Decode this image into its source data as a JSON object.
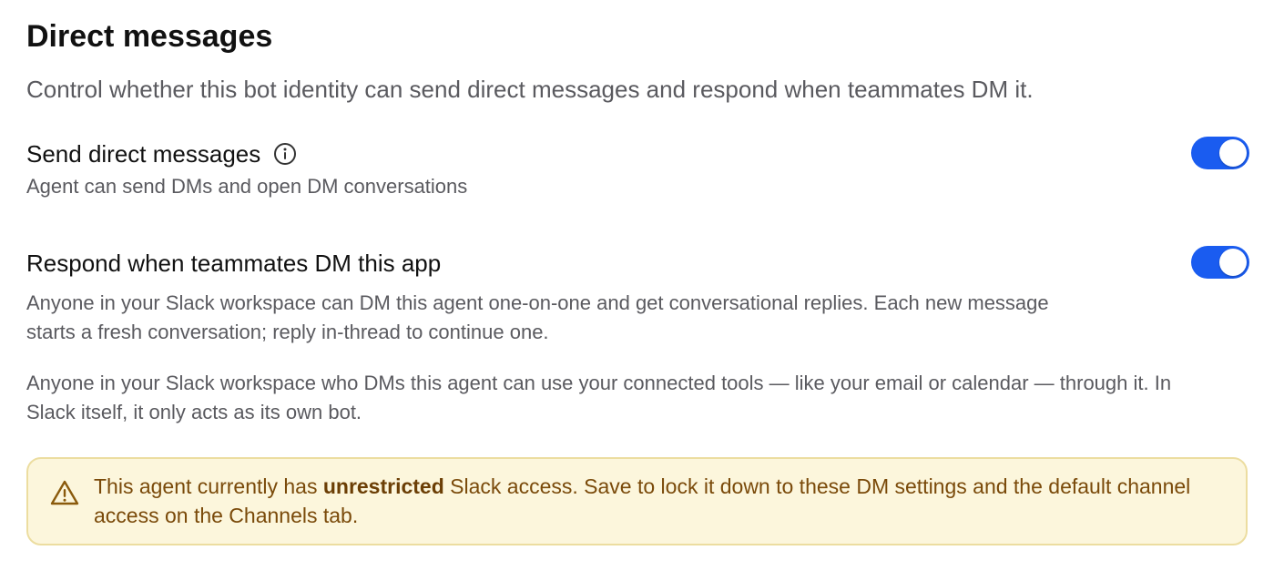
{
  "section": {
    "title": "Direct messages",
    "description": "Control whether this bot identity can send direct messages and respond when teammates DM it."
  },
  "settings": [
    {
      "title": "Send direct messages",
      "icon": "info-icon",
      "description": "Agent can send DMs and open DM conversations",
      "enabled": true
    },
    {
      "title": "Respond when teammates DM this app",
      "description": "Anyone in your Slack workspace can DM this agent one-on-one and get conversational replies. Each new message starts a fresh conversation; reply in-thread to continue one.",
      "note": "Anyone in your Slack workspace who DMs this agent can use your connected tools — like your email or calendar — through it. In Slack itself, it only acts as its own bot.",
      "enabled": true
    }
  ],
  "warning": {
    "icon": "warning-triangle-icon",
    "prefix": "This agent currently has ",
    "emphasis": "unrestricted",
    "suffix": " Slack access. Save to lock it down to these DM settings and the default channel access on the Channels tab."
  },
  "colors": {
    "toggle_on": "#1a5cf0",
    "warning_bg": "#fcf6dc",
    "warning_border": "#ecdda0",
    "warning_text": "#7a4a0a"
  }
}
